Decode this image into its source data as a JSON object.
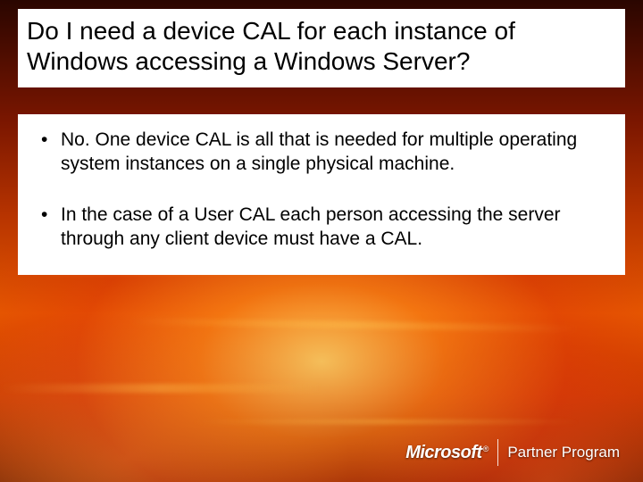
{
  "title": "Do I need a device CAL for each instance of Windows accessing a Windows Server?",
  "bullets": [
    "No.  One device CAL is all that is needed for multiple operating system  instances on a single physical machine.",
    "In the case of a User CAL each person accessing the server through any client device must have a CAL."
  ],
  "footer": {
    "brand": "Microsoft",
    "registered": "®",
    "program": "Partner Program"
  }
}
